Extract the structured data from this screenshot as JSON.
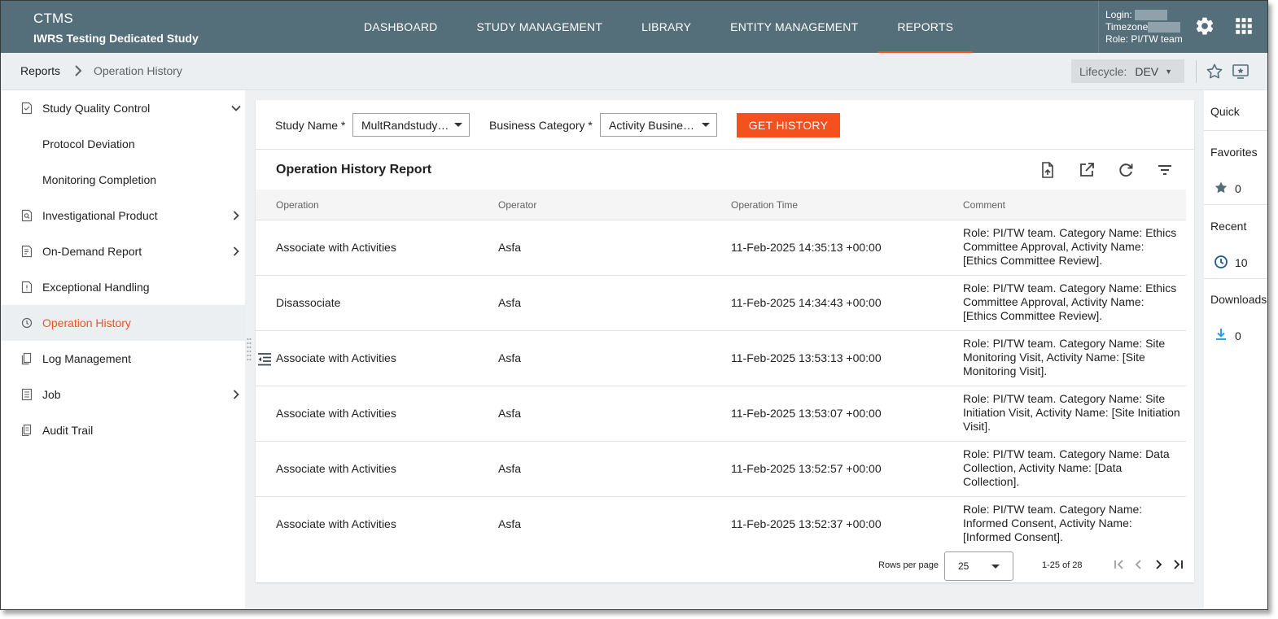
{
  "header": {
    "app_name": "CTMS",
    "study_name": "IWRS Testing Dedicated Study",
    "nav": [
      "DASHBOARD",
      "STUDY MANAGEMENT",
      "LIBRARY",
      "ENTITY MANAGEMENT",
      "REPORTS"
    ],
    "active_nav": "REPORTS",
    "login_label": "Login:",
    "timezone_label": "Timezone",
    "role_label": "Role:",
    "role_value": "PI/TW team",
    "icons": [
      "gear-icon",
      "apps-grid-icon"
    ]
  },
  "breadcrumb": {
    "root": "Reports",
    "separator": ">",
    "current": "Operation History",
    "lifecycle_label": "Lifecycle:",
    "lifecycle_value": "DEV"
  },
  "sidebar": {
    "items": [
      {
        "label": "Study Quality Control",
        "icon": "report-check-icon",
        "chevron": "down"
      },
      {
        "label": "Protocol Deviation",
        "sub": true
      },
      {
        "label": "Monitoring Completion",
        "sub": true
      },
      {
        "label": "Investigational Product",
        "icon": "report-search-icon",
        "chevron": "right"
      },
      {
        "label": "On-Demand Report",
        "icon": "report-user-icon",
        "chevron": "right"
      },
      {
        "label": "Exceptional Handling",
        "icon": "document-alert-icon"
      },
      {
        "label": "Operation History",
        "icon": "history-icon",
        "active": true
      },
      {
        "label": "Log Management",
        "icon": "log-copy-icon"
      },
      {
        "label": "Job",
        "icon": "job-list-icon",
        "chevron": "right"
      },
      {
        "label": "Audit Trail",
        "icon": "audit-icon"
      }
    ]
  },
  "filters": {
    "study_name_label": "Study Name *",
    "study_name_value": "MultRandstudy…",
    "business_category_label": "Business Category *",
    "business_category_value": "Activity Busine…",
    "get_history_label": "GET HISTORY"
  },
  "report": {
    "title": "Operation History Report",
    "columns": [
      "Operation",
      "Operator",
      "Operation Time",
      "Comment"
    ],
    "rows": [
      {
        "operation": "Associate with Activities",
        "operator": "Asfa",
        "time": "11-Feb-2025 14:35:13 +00:00",
        "comment": "Role: PI/TW team. Category Name: Ethics Committee Approval, Activity Name: [Ethics Committee Review]."
      },
      {
        "operation": "Disassociate",
        "operator": "Asfa",
        "time": "11-Feb-2025 14:34:43 +00:00",
        "comment": "Role: PI/TW team. Category Name: Ethics Committee Approval, Activity Name: [Ethics Committee Review]."
      },
      {
        "operation": "Associate with Activities",
        "operator": "Asfa",
        "time": "11-Feb-2025 13:53:13 +00:00",
        "comment": "Role: PI/TW team. Category Name: Site Monitoring Visit, Activity Name: [Site Monitoring Visit]."
      },
      {
        "operation": "Associate with Activities",
        "operator": "Asfa",
        "time": "11-Feb-2025 13:53:07 +00:00",
        "comment": "Role: PI/TW team. Category Name: Site Initiation Visit, Activity Name: [Site Initiation Visit]."
      },
      {
        "operation": "Associate with Activities",
        "operator": "Asfa",
        "time": "11-Feb-2025 13:52:57 +00:00",
        "comment": "Role: PI/TW team. Category Name: Data Collection, Activity Name: [Data Collection]."
      },
      {
        "operation": "Associate with Activities",
        "operator": "Asfa",
        "time": "11-Feb-2025 13:52:37 +00:00",
        "comment": "Role: PI/TW team. Category Name: Informed Consent, Activity Name: [Informed Consent]."
      }
    ],
    "toolbar_icons": [
      "export-file-icon",
      "open-external-icon",
      "refresh-icon",
      "filter-icon"
    ]
  },
  "pagination": {
    "rows_per_page_label": "Rows per page",
    "rows_per_page_value": "25",
    "range": "1-25 of 28"
  },
  "quick_panel": {
    "quick_label": "Quick",
    "favorites_label": "Favorites",
    "favorites_count": "0",
    "recent_label": "Recent",
    "recent_count": "10",
    "downloads_label": "Downloads",
    "downloads_count": "0"
  },
  "colors": {
    "header_bg": "#546e7a",
    "accent": "#f4511e",
    "download_icon": "#29a3e6",
    "clock_icon": "#1e5a8c"
  }
}
